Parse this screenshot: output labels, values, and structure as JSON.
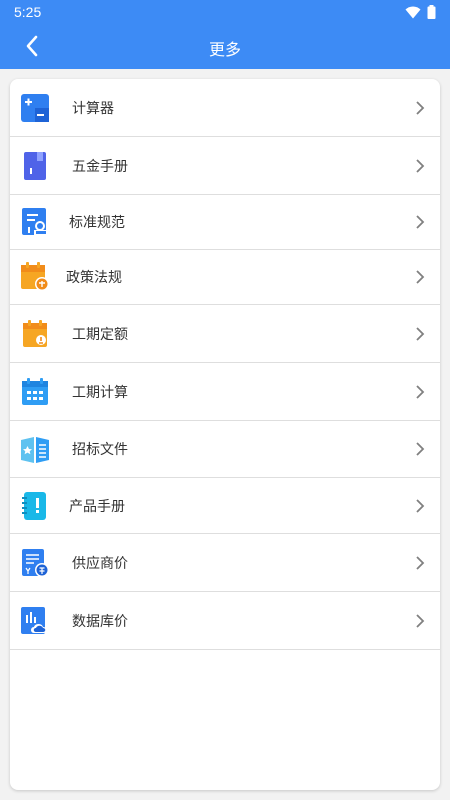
{
  "status": {
    "time": "5:25",
    "icons": [
      "wifi-icon",
      "battery-icon"
    ]
  },
  "header": {
    "title": "更多",
    "back_icon": "back-arrow-icon"
  },
  "colors": {
    "primary": "#3d8bf5",
    "background": "#f2f2f2",
    "card": "#ffffff",
    "divider": "#dedede",
    "chevron": "#808080"
  },
  "menu": {
    "items": [
      {
        "label": "计算器",
        "icon": "calculator-icon"
      },
      {
        "label": "五金手册",
        "icon": "hardware-manual-icon"
      },
      {
        "label": "标准规范",
        "icon": "standard-spec-icon"
      },
      {
        "label": "政策法规",
        "icon": "policy-law-icon"
      },
      {
        "label": "工期定额",
        "icon": "duration-quota-icon"
      },
      {
        "label": "工期计算",
        "icon": "calendar-icon"
      },
      {
        "label": "招标文件",
        "icon": "tender-document-icon"
      },
      {
        "label": "产品手册",
        "icon": "product-manual-icon"
      },
      {
        "label": "供应商价",
        "icon": "supplier-price-icon"
      },
      {
        "label": "数据库价",
        "icon": "database-price-icon"
      }
    ]
  }
}
